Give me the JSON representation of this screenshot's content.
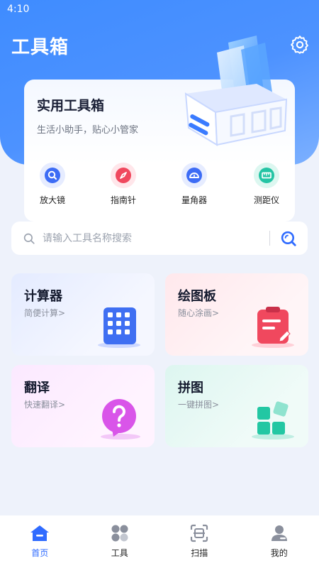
{
  "status": {
    "time": "4:10"
  },
  "header": {
    "title": "工具箱"
  },
  "hero": {
    "title": "实用工具箱",
    "subtitle": "生活小助手，贴心小管家",
    "quick_tools": [
      {
        "label": "放大镜",
        "icon": "magnifier-icon",
        "color": "#3d6cf5"
      },
      {
        "label": "指南针",
        "icon": "compass-icon",
        "color": "#f0485e"
      },
      {
        "label": "量角器",
        "icon": "protractor-icon",
        "color": "#3d6cf5"
      },
      {
        "label": "测距仪",
        "icon": "ruler-icon",
        "color": "#24c4a4"
      }
    ]
  },
  "search": {
    "placeholder": "请输入工具名称搜索"
  },
  "tools": [
    {
      "title": "计算器",
      "subtitle": "简便计算>",
      "icon": "calculator-icon"
    },
    {
      "title": "绘图板",
      "subtitle": "随心涂画>",
      "icon": "drawing-board-icon"
    },
    {
      "title": "翻译",
      "subtitle": "快速翻译>",
      "icon": "translate-icon"
    },
    {
      "title": "拼图",
      "subtitle": "一键拼图>",
      "icon": "puzzle-icon"
    }
  ],
  "tabbar": {
    "items": [
      {
        "label": "首页",
        "icon": "home-icon",
        "active": true
      },
      {
        "label": "工具",
        "icon": "tools-grid-icon",
        "active": false
      },
      {
        "label": "扫描",
        "icon": "scan-icon",
        "active": false
      },
      {
        "label": "我的",
        "icon": "user-icon",
        "active": false
      }
    ]
  },
  "colors": {
    "primary": "#2f6bff",
    "hero_bg": "#4a8fff",
    "background": "#eef2fb"
  }
}
